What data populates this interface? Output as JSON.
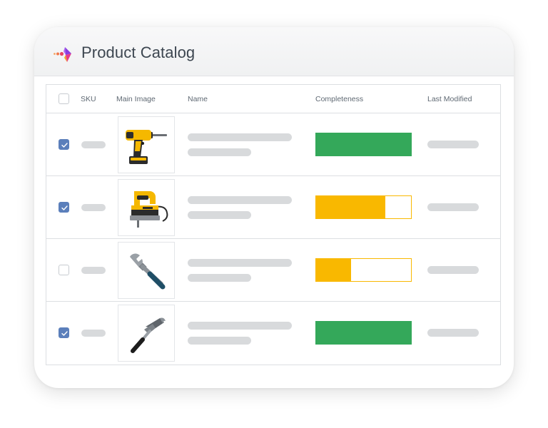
{
  "header": {
    "title": "Product Catalog",
    "logo_icon": "brand-logo-icon"
  },
  "table": {
    "columns": {
      "sku": "SKU",
      "image": "Main Image",
      "name": "Name",
      "completeness": "Completeness",
      "modified": "Last Modified"
    },
    "select_all_checked": false,
    "rows": [
      {
        "checked": true,
        "image_icon": "cordless-drill-icon",
        "completeness": 1.0,
        "status_color": "#34a85a"
      },
      {
        "checked": true,
        "image_icon": "jigsaw-icon",
        "completeness": 0.73,
        "status_color": "#f9b800"
      },
      {
        "checked": false,
        "image_icon": "adjustable-wrench-icon",
        "completeness": 0.37,
        "status_color": "#f9b800"
      },
      {
        "checked": true,
        "image_icon": "hammer-icon",
        "completeness": 1.0,
        "status_color": "#34a85a"
      }
    ]
  },
  "colors": {
    "checkbox_checked": "#5b7fbb",
    "complete": "#34a85a",
    "incomplete": "#f9b800",
    "placeholder": "#d8dadc"
  }
}
